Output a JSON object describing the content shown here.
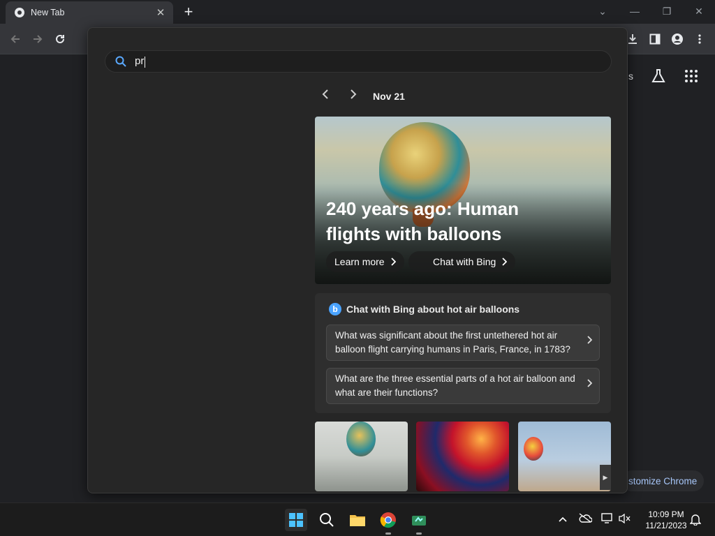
{
  "browser": {
    "tab_title": "New Tab",
    "tab_close": "✕",
    "new_tab": "+",
    "window_controls": [
      "⌄",
      "—",
      "❐",
      "✕"
    ]
  },
  "omnibox": {
    "query": "pr"
  },
  "bing": {
    "date": "Nov 21",
    "headline": "240 years ago: Human flights with balloons",
    "learn_more": "Learn more",
    "chat_with_bing": "Chat with Bing",
    "chat_header": "Chat with Bing about hot air balloons",
    "suggestions": [
      "What was significant about the first untethered hot air balloon flight carrying humans in Paris, France, in 1783?",
      "What are the three essential parts of a hot air balloon and what are their functions?"
    ]
  },
  "page": {
    "right_partial_text": "s",
    "customize_partial": "stomize Chrome"
  },
  "taskbar": {
    "time": "10:09 PM",
    "date": "11/21/2023"
  },
  "colors": {
    "accent": "#a8c7fa",
    "bing_blue": "#4aa3ff"
  }
}
